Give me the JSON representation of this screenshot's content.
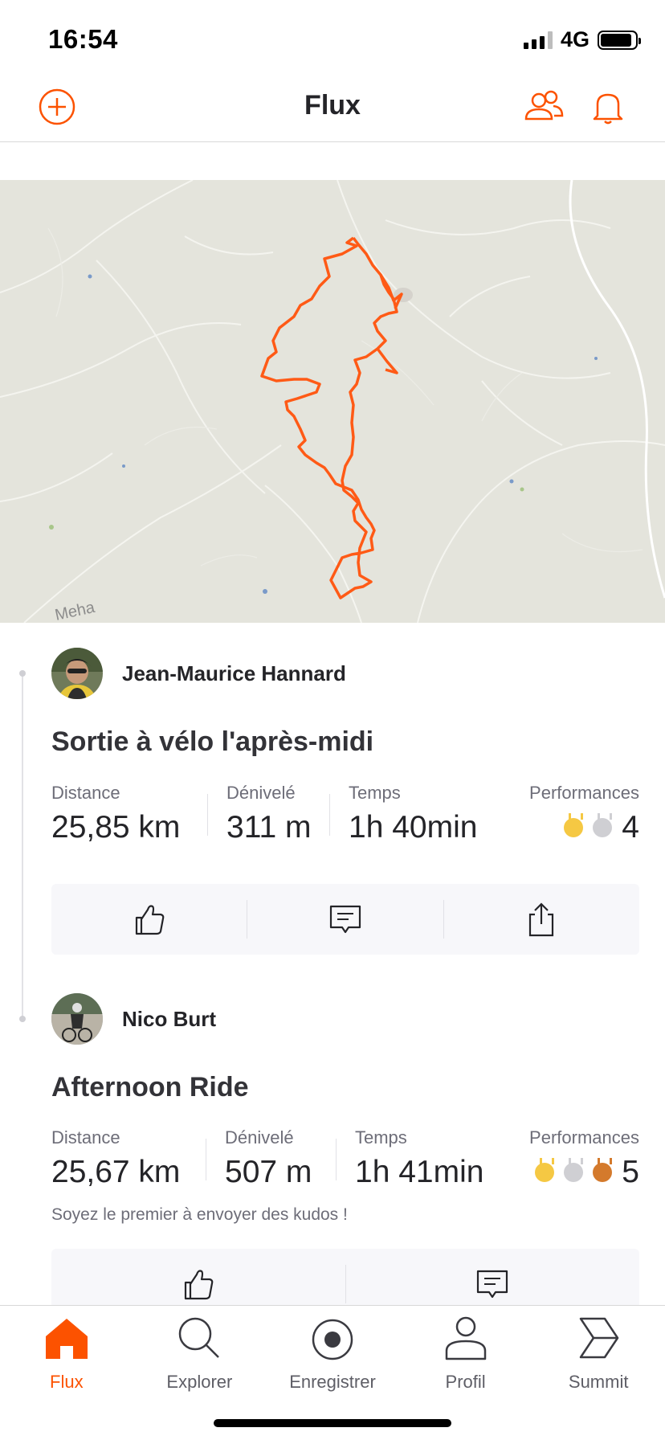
{
  "status_bar": {
    "time": "16:54",
    "network": "4G"
  },
  "header": {
    "title": "Flux"
  },
  "map": {
    "label": "Meha"
  },
  "colors": {
    "accent": "#fc5200",
    "gold": "#f5c843",
    "silver": "#cfcfd3",
    "bronze": "#d47a2c"
  },
  "activities": [
    {
      "athlete": "Jean-Maurice Hannard",
      "title": "Sortie à vélo l'après-midi",
      "stats": [
        {
          "label": "Distance",
          "value": "25,85 km"
        },
        {
          "label": "Dénivelé",
          "value": "311 m"
        },
        {
          "label": "Temps",
          "value": "1h 40min"
        }
      ],
      "performances": {
        "label": "Performances",
        "count": "4",
        "medals": [
          "gold",
          "silver"
        ]
      },
      "actions": [
        "kudos-icon",
        "comment-icon",
        "share-icon"
      ]
    },
    {
      "athlete": "Nico Burt",
      "title": "Afternoon Ride",
      "stats": [
        {
          "label": "Distance",
          "value": "25,67 km"
        },
        {
          "label": "Dénivelé",
          "value": "507 m"
        },
        {
          "label": "Temps",
          "value": "1h 41min"
        }
      ],
      "performances": {
        "label": "Performances",
        "count": "5",
        "medals": [
          "gold",
          "silver",
          "bronze"
        ]
      },
      "kudos_prompt": "Soyez le premier à envoyer des kudos !",
      "actions": [
        "kudos-icon",
        "comment-icon"
      ]
    }
  ],
  "tabs": [
    {
      "label": "Flux",
      "icon": "home-icon",
      "active": true
    },
    {
      "label": "Explorer",
      "icon": "search-icon",
      "active": false
    },
    {
      "label": "Enregistrer",
      "icon": "record-icon",
      "active": false
    },
    {
      "label": "Profil",
      "icon": "profile-icon",
      "active": false
    },
    {
      "label": "Summit",
      "icon": "summit-icon",
      "active": false
    }
  ]
}
